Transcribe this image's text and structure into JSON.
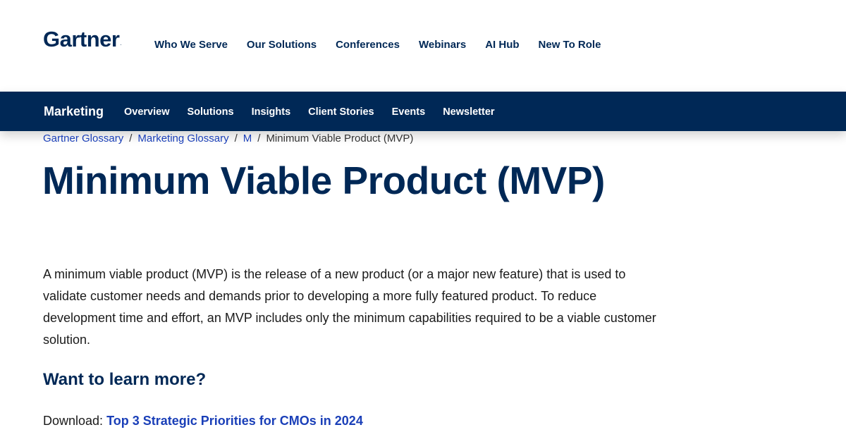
{
  "header": {
    "logo_text": "Gartner",
    "logo_mark": ".",
    "nav": [
      "Who We Serve",
      "Our Solutions",
      "Conferences",
      "Webinars",
      "AI Hub",
      "New To Role"
    ]
  },
  "sub_nav": {
    "section": "Marketing",
    "links": [
      "Overview",
      "Solutions",
      "Insights",
      "Client Stories",
      "Events",
      "Newsletter"
    ]
  },
  "breadcrumb": {
    "items": [
      "Gartner Glossary",
      "Marketing Glossary",
      "M"
    ],
    "separator": "/",
    "current": "Minimum Viable Product (MVP)"
  },
  "main": {
    "title": "Minimum Viable Product (MVP)",
    "description": "A minimum viable product (MVP) is the release of a new product (or a major new feature) that is used to validate customer needs and demands prior to developing a more fully featured product. To reduce development time and effort, an MVP includes only the minimum capabilities required to be a viable customer solution.",
    "learn_more_heading": "Want to learn more?",
    "download_label": "Download:",
    "download_link": "Top 3 Strategic Priorities for CMOs in 2024"
  },
  "colors": {
    "brand_navy": "#002856",
    "link_blue": "#1a3fb8",
    "background": "#ffffff"
  }
}
